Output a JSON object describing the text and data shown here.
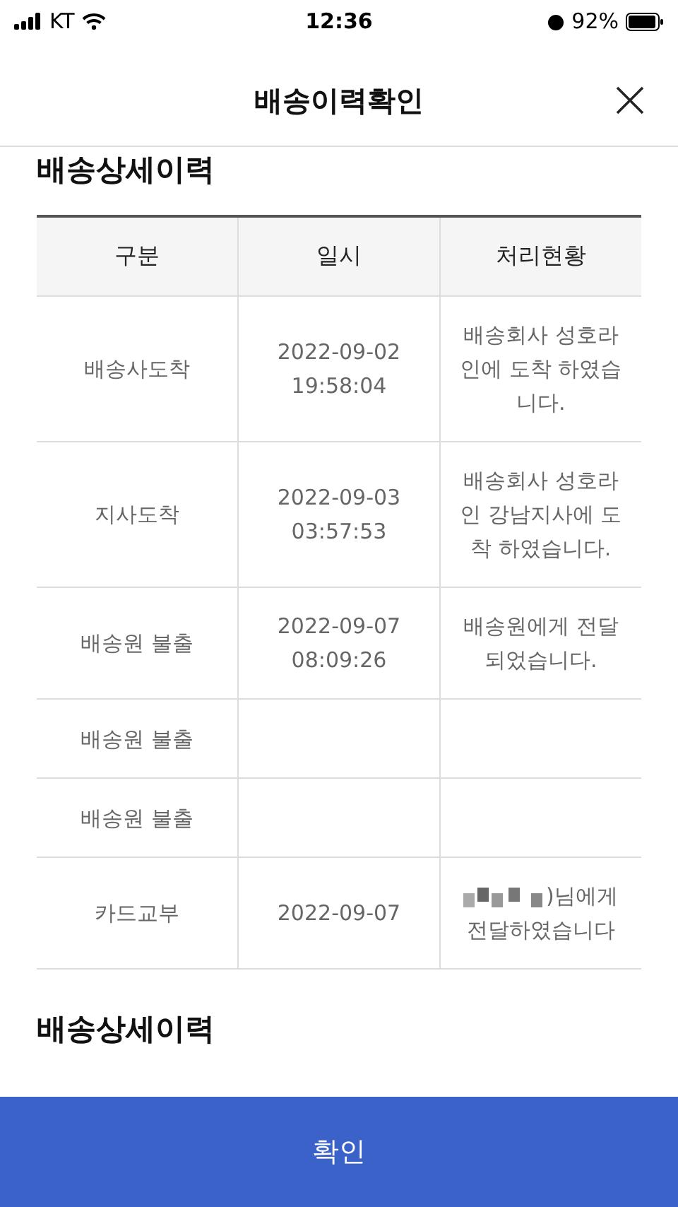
{
  "status_bar": {
    "carrier": "KT",
    "time": "12:36",
    "battery": "92%"
  },
  "header": {
    "title": "배송이력확인"
  },
  "sections": [
    {
      "title": "배송상세이력",
      "table": {
        "columns": [
          "구분",
          "일시",
          "처리현황"
        ],
        "rows": [
          {
            "kind": "plain",
            "cells": [
              "배송사도착",
              "2022-09-02 19:58:04",
              "배송회사 성호라인에 도착 하였습니다."
            ]
          },
          {
            "kind": "plain",
            "cells": [
              "지사도착",
              "2022-09-03 03:57:53",
              "배송회사 성호라인 강남지사에 도착 하였습니다."
            ]
          },
          {
            "kind": "plain",
            "cells": [
              "배송원 불출",
              "2022-09-07 08:09:26",
              "배송원에게 전달되었습니다."
            ]
          },
          {
            "kind": "plain",
            "cells": [
              "배송원 불출",
              "",
              ""
            ]
          },
          {
            "kind": "plain",
            "cells": [
              "배송원 불출",
              "",
              ""
            ]
          },
          {
            "kind": "redacted",
            "cells": [
              "카드교부",
              "2022-09-07",
              ")님에게 전달하였습니다"
            ]
          }
        ]
      }
    },
    {
      "title": "배송상세이력"
    }
  ],
  "confirm_button": "확인"
}
